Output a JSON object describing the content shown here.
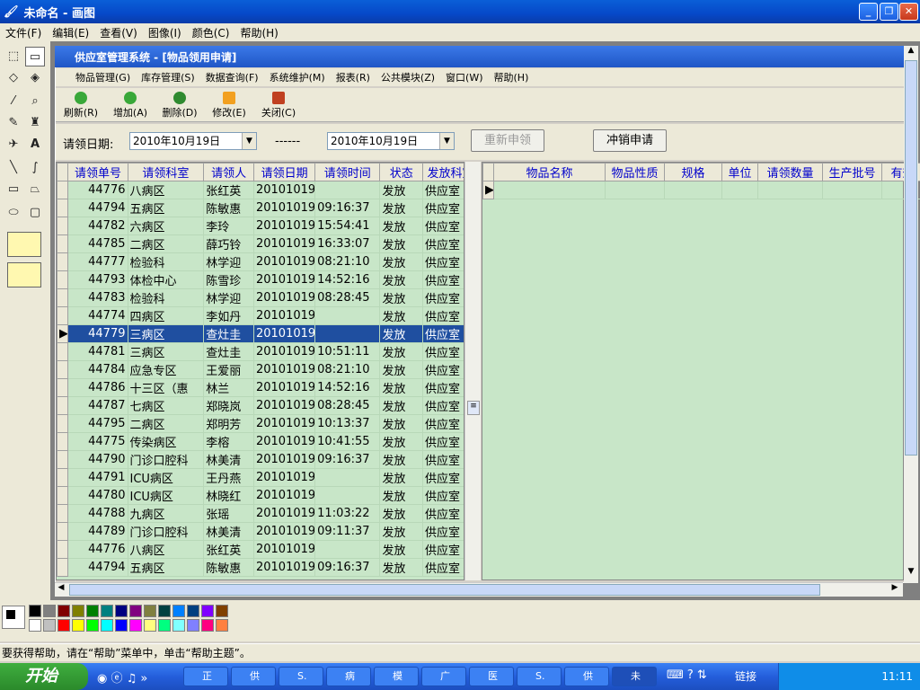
{
  "paint_window": {
    "title": "未命名 - 画图",
    "menu": [
      "文件(F)",
      "编辑(E)",
      "查看(V)",
      "图像(I)",
      "颜色(C)",
      "帮助(H)"
    ],
    "status": "要获得帮助，请在“帮助”菜单中，单击“帮助主题”。"
  },
  "app": {
    "title": "供应室管理系统 - [物品领用申请]",
    "menu": [
      "物品管理(G)",
      "库存管理(S)",
      "数据查询(F)",
      "系统维护(M)",
      "报表(R)",
      "公共模块(Z)",
      "窗口(W)",
      "帮助(H)"
    ],
    "toolbar": [
      {
        "label": "刷新(R)",
        "color": "#39a839"
      },
      {
        "label": "增加(A)",
        "color": "#39a839"
      },
      {
        "label": "删除(D)",
        "color": "#2f8a2f"
      },
      {
        "label": "修改(E)",
        "color": "#f2a020"
      },
      {
        "label": "关闭(C)",
        "color": "#c04020"
      }
    ],
    "filter": {
      "label": "请领日期:",
      "date_from": "2010年10月19日",
      "separator": "------",
      "date_to": "2010年10月19日",
      "reapply_button": "重新申领",
      "writeoff_button": "冲销申请"
    },
    "left_grid": {
      "columns": [
        "请领单号",
        "请领科室",
        "请领人",
        "请领日期",
        "请领时间",
        "状态",
        "发放科室"
      ],
      "rows": [
        [
          "44776",
          "八病区",
          "张红英",
          "20101019",
          "",
          "发放",
          "供应室"
        ],
        [
          "44794",
          "五病区",
          "陈敏惠",
          "20101019",
          "09:16:37",
          "发放",
          "供应室"
        ],
        [
          "44782",
          "六病区",
          "李玲",
          "20101019",
          "15:54:41",
          "发放",
          "供应室"
        ],
        [
          "44785",
          "二病区",
          "薛巧铃",
          "20101019",
          "16:33:07",
          "发放",
          "供应室"
        ],
        [
          "44777",
          "检验科",
          "林学迎",
          "20101019",
          "08:21:10",
          "发放",
          "供应室"
        ],
        [
          "44793",
          "体检中心",
          "陈雪珍",
          "20101019",
          "14:52:16",
          "发放",
          "供应室"
        ],
        [
          "44783",
          "检验科",
          "林学迎",
          "20101019",
          "08:28:45",
          "发放",
          "供应室"
        ],
        [
          "44774",
          "四病区",
          "李如丹",
          "20101019",
          "",
          "发放",
          "供应室"
        ],
        [
          "44779",
          "三病区",
          "查灶圭",
          "20101019",
          "",
          "发放",
          "供应室"
        ],
        [
          "44781",
          "三病区",
          "查灶圭",
          "20101019",
          "10:51:11",
          "发放",
          "供应室"
        ],
        [
          "44784",
          "应急专区",
          "王爱丽",
          "20101019",
          "08:21:10",
          "发放",
          "供应室"
        ],
        [
          "44786",
          "十三区（惠",
          "林兰",
          "20101019",
          "14:52:16",
          "发放",
          "供应室"
        ],
        [
          "44787",
          "七病区",
          "郑晓岚",
          "20101019",
          "08:28:45",
          "发放",
          "供应室"
        ],
        [
          "44795",
          "二病区",
          "郑明芳",
          "20101019",
          "10:13:37",
          "发放",
          "供应室"
        ],
        [
          "44775",
          "传染病区",
          "李榕",
          "20101019",
          "10:41:55",
          "发放",
          "供应室"
        ],
        [
          "44790",
          "门诊口腔科",
          "林美清",
          "20101019",
          "09:16:37",
          "发放",
          "供应室"
        ],
        [
          "44791",
          "ICU病区",
          "王丹燕",
          "20101019",
          "",
          "发放",
          "供应室"
        ],
        [
          "44780",
          "ICU病区",
          "林晓红",
          "20101019",
          "",
          "发放",
          "供应室"
        ],
        [
          "44788",
          "九病区",
          "张瑶",
          "20101019",
          "11:03:22",
          "发放",
          "供应室"
        ],
        [
          "44789",
          "门诊口腔科",
          "林美清",
          "20101019",
          "09:11:37",
          "发放",
          "供应室"
        ],
        [
          "44776",
          "八病区",
          "张红英",
          "20101019",
          "",
          "发放",
          "供应室"
        ],
        [
          "44794",
          "五病区",
          "陈敏惠",
          "20101019",
          "09:16:37",
          "发放",
          "供应室"
        ]
      ],
      "selected_row": 8
    },
    "right_grid": {
      "columns": [
        "物品名称",
        "物品性质",
        "规格",
        "单位",
        "请领数量",
        "生产批号",
        "有效"
      ]
    }
  },
  "taskbar": {
    "start": "开始",
    "tasks": [
      "正",
      "供",
      "S.",
      "病",
      "模",
      "广",
      "医",
      "S.",
      "供",
      "未"
    ],
    "links": "链接",
    "clock": "11:11"
  }
}
